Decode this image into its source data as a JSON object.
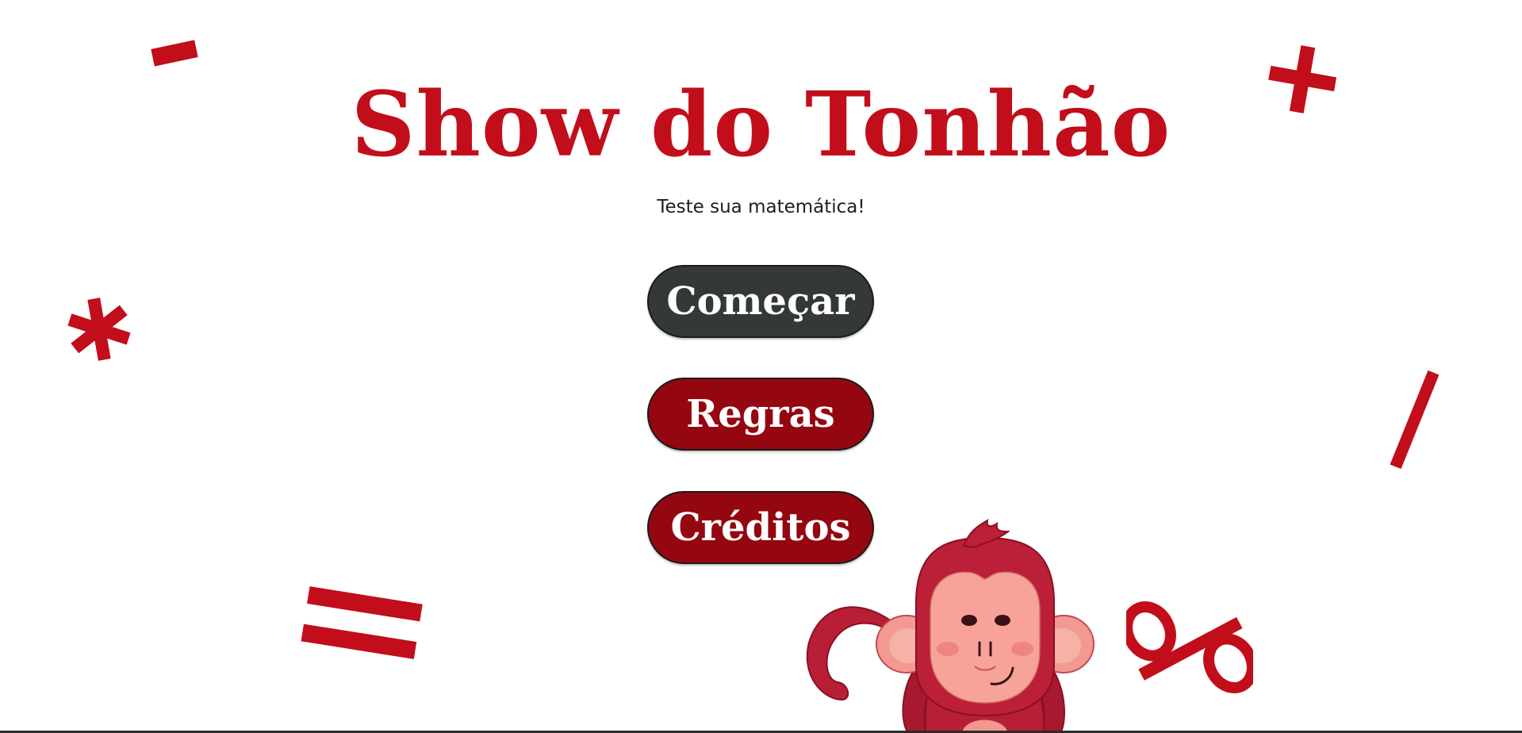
{
  "header": {
    "title": "Show do Tonhão",
    "subtitle": "Teste sua matemática!"
  },
  "menu": {
    "start_label": "Começar",
    "rules_label": "Regras",
    "credits_label": "Créditos"
  },
  "decor": {
    "symbols": [
      "-",
      "+",
      "*",
      "/",
      "=",
      "%"
    ],
    "mascot": "monkey-icon"
  },
  "colors": {
    "accent": "#c20e1a",
    "button_primary": "#353839",
    "button_secondary": "#950710",
    "background": "#ffffff"
  }
}
